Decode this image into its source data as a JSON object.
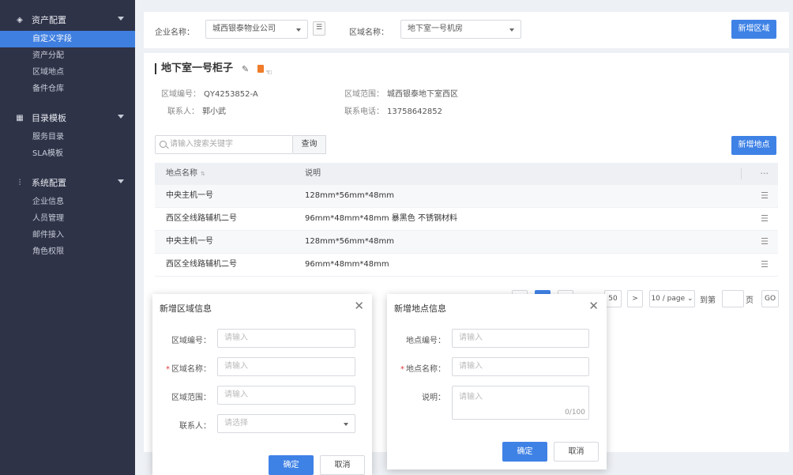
{
  "sidebar": {
    "groups": [
      {
        "title": "资产配置",
        "icon": "layers-icon",
        "items": [
          "自定义字段",
          "资产分配",
          "区域地点",
          "备件仓库"
        ],
        "active_index": 0
      },
      {
        "title": "目录模板",
        "icon": "grid-icon",
        "items": [
          "服务目录",
          "SLA模板"
        ]
      },
      {
        "title": "系统配置",
        "icon": "sliders-icon",
        "items": [
          "企业信息",
          "人员管理",
          "邮件接入",
          "角色权限"
        ]
      }
    ]
  },
  "filter": {
    "company_label": "企业名称：",
    "company_value": "城西银泰物业公司",
    "area_label": "区域名称：",
    "area_value": "地下室一号机房",
    "add_area_button": "新增区域"
  },
  "detail": {
    "title": "地下室一号柜子",
    "code_label": "区域编号：",
    "code_value": "QY4253852-A",
    "range_label": "区域范围：",
    "range_value": "城西银泰地下室西区",
    "contact_label": "联系人：",
    "contact_value": "郭小武",
    "phone_label": "联系电话：",
    "phone_value": "13758642852"
  },
  "search": {
    "placeholder": "请输入搜索关键字",
    "button": "查询",
    "add_location_button": "新增地点"
  },
  "table": {
    "col_name": "地点名称",
    "col_desc": "说明",
    "col_more": "···",
    "rows": [
      {
        "name": "中央主机一号",
        "desc": "128mm*56mm*48mm"
      },
      {
        "name": "西区全线路辅机二号",
        "desc": "96mm*48mm*48mm 暴黑色 不锈钢材料"
      },
      {
        "name": "中央主机一号",
        "desc": "128mm*56mm*48mm"
      },
      {
        "name": "西区全线路辅机二号",
        "desc": "96mm*48mm*48mm"
      }
    ]
  },
  "pagination": {
    "page_size": "50",
    "next": ">",
    "per_page": "10 / page",
    "goto_label": "到第",
    "page_suffix": "页",
    "go_button": "GO"
  },
  "area_dialog": {
    "title": "新增区域信息",
    "code_label": "区域编号：",
    "code_placeholder": "请输入",
    "name_label": "区域名称：",
    "name_placeholder": "请输入",
    "range_label": "区域范围：",
    "range_placeholder": "请输入",
    "contact_label": "联系人：",
    "contact_placeholder": "请选择",
    "confirm": "确定",
    "cancel": "取消"
  },
  "location_dialog": {
    "title": "新增地点信息",
    "code_label": "地点编号：",
    "code_placeholder": "请输入",
    "name_label": "地点名称：",
    "name_placeholder": "请输入",
    "desc_label": "说明：",
    "desc_placeholder": "请输入",
    "counter": "0/100",
    "confirm": "确定",
    "cancel": "取消"
  },
  "colors": {
    "sidebar_bg": "#2e3348",
    "accent": "#3f82e6",
    "danger": "#e4393c",
    "trash": "#f07b2a"
  }
}
